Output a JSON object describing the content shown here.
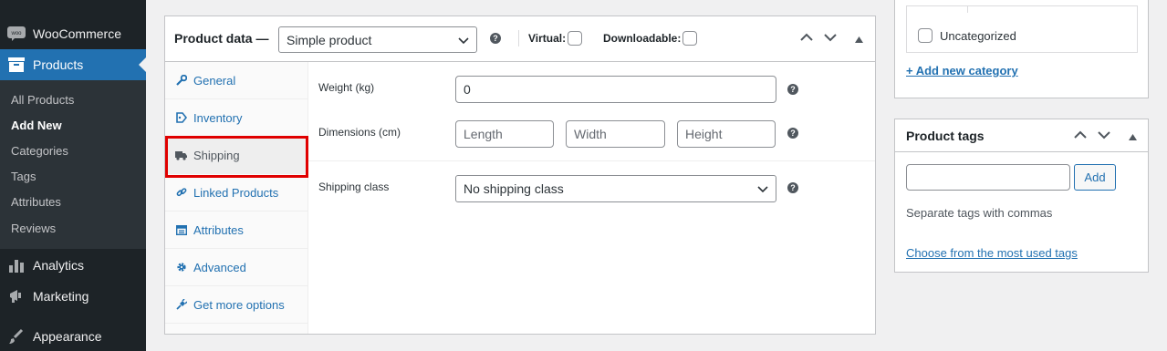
{
  "sidebar": {
    "woocommerce": "WooCommerce",
    "products": "Products",
    "submenu": [
      "All Products",
      "Add New",
      "Categories",
      "Tags",
      "Attributes",
      "Reviews"
    ],
    "analytics": "Analytics",
    "marketing": "Marketing",
    "appearance": "Appearance"
  },
  "product_data": {
    "title": "Product data —",
    "product_type": "Simple product",
    "virtual_label": "Virtual:",
    "downloadable_label": "Downloadable:",
    "tabs": [
      "General",
      "Inventory",
      "Shipping",
      "Linked Products",
      "Attributes",
      "Advanced",
      "Get more options"
    ],
    "active_tab": "Shipping",
    "weight_label": "Weight (kg)",
    "weight_value": "0",
    "dimensions_label": "Dimensions (cm)",
    "length_placeholder": "Length",
    "width_placeholder": "Width",
    "height_placeholder": "Height",
    "shipping_class_label": "Shipping class",
    "shipping_class_value": "No shipping class"
  },
  "categories": {
    "uncategorized": "Uncategorized",
    "add_new": "+ Add new category"
  },
  "tags": {
    "title": "Product tags",
    "add_button": "Add",
    "hint": "Separate tags with commas",
    "most_used_link": "Choose from the most used tags"
  },
  "colors": {
    "admin_dark": "#1d2327",
    "admin_blue": "#2271b1",
    "highlight_red": "#e00000"
  }
}
